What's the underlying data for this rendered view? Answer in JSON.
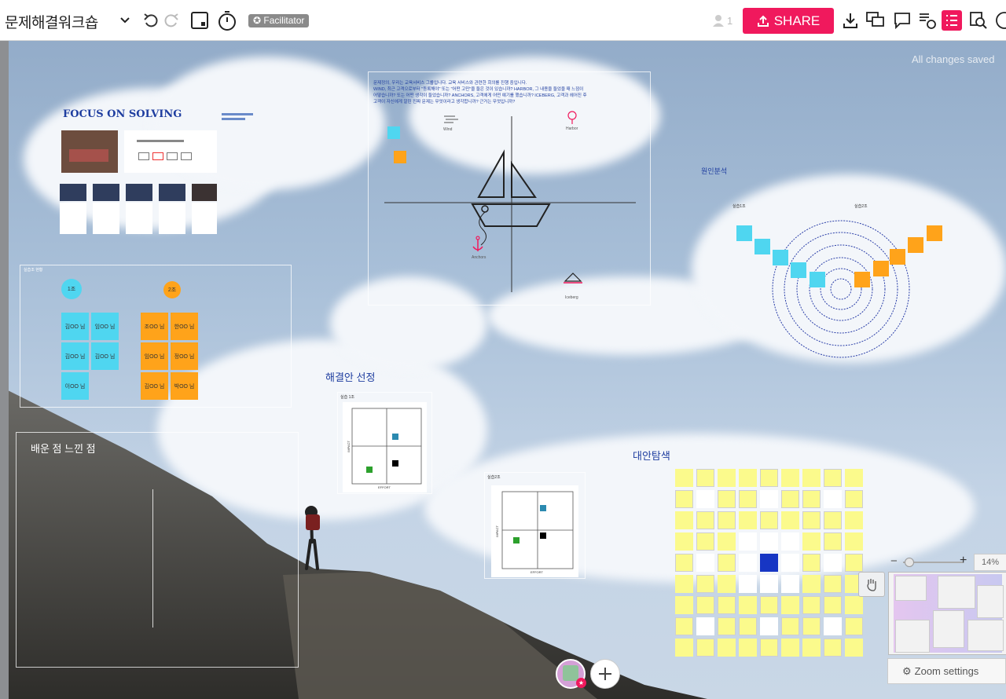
{
  "app": {
    "board_title": "문제해결워크숍",
    "facilitator_badge": "Facilitator",
    "user_count": "1",
    "share_label": "SHARE",
    "saved_status": "All changes saved",
    "accent": "#f0195d"
  },
  "toolbar_icons": [
    "chevron-down-icon",
    "undo-icon",
    "redo-icon",
    "frame-icon",
    "timer-icon",
    "user-icon",
    "download-icon",
    "comments-icon",
    "chat-icon",
    "activity-icon",
    "outline-icon",
    "search-icon",
    "help-icon"
  ],
  "board": {
    "focus_title": "FOCUS ON SOLVING",
    "practice_status": {
      "title": "실습조 현황",
      "group1": "1조",
      "group2": "2조",
      "group1_members": [
        "김OO 님",
        "임OO 님",
        "김OO 님",
        "김OO 님",
        "이OO 님"
      ],
      "group2_members": [
        "조OO 님",
        "한OO 님",
        "임OO 님",
        "정OO 님",
        "김OO 님",
        "박OO 님"
      ]
    },
    "learned_title": "배운 점 느낀 점",
    "sailboat": {
      "intro_line1": "문제정의, 우리는 교육서비스 그룹입니다. 교육 서비스와 관련한 회의를 진행 중입니다.",
      "intro_line2": "WIND, 최근 고객으로부터 \"등록해야\" 또는 \"어떤 고민\"을 들은 것이 있습니까? HARBOR, 그 내용을 들었을 때 느낌이",
      "intro_line3": "어떻습니까? 또는 어떤 생각이 들었습니까? ANCHORS, 고객에게 어떤 얘기를 했습니까? ICEBERG, 고객과 헤어진 후",
      "intro_line4": "고객이 자신에게 알린 진짜 문제는 무엇이라고 생각합니까? 근거는 무엇입니까?",
      "wind": "Wind",
      "harbor": "Harbor",
      "anchors": "Anchors",
      "iceberg": "Iceberg"
    },
    "root_cause": {
      "title": "원인분석",
      "left_label": "실습1조",
      "right_label": "실습2조"
    },
    "solution_select": {
      "title": "해결안 선정",
      "group1_label": "실습 1조",
      "group2_label": "실습2조",
      "axis_x": "EFFORT",
      "axis_y": "IMPACT"
    },
    "alternatives": {
      "title": "대안탐색"
    }
  },
  "zoom": {
    "minus": "−",
    "plus": "+",
    "level": "14%",
    "settings_label": "Zoom settings"
  }
}
